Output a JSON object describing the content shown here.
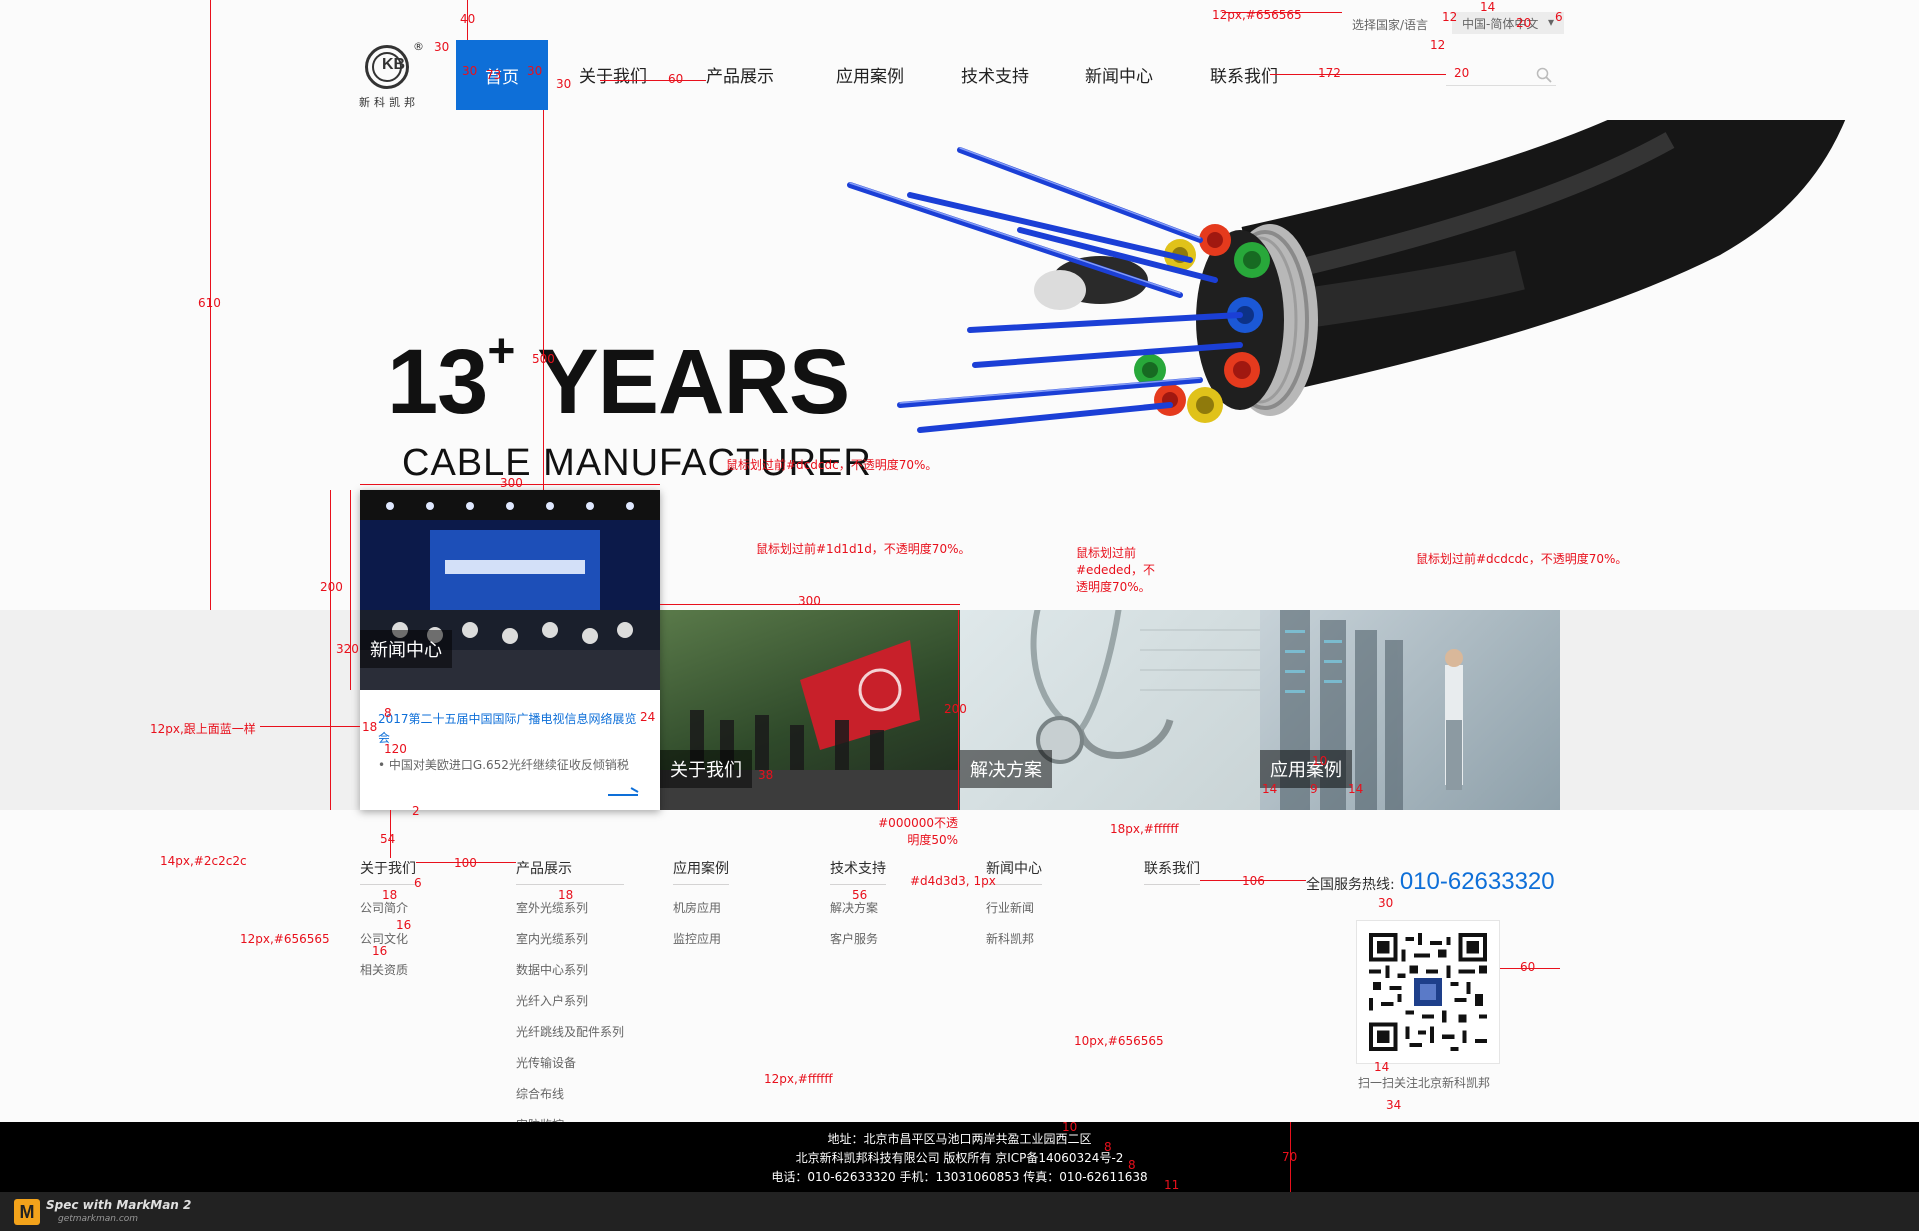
{
  "header": {
    "logo_mark": "KB",
    "logo_reg": "®",
    "logo_name": "新科凯邦",
    "home_label": "首页",
    "nav": [
      "关于我们",
      "产品展示",
      "应用案例",
      "技术支持",
      "新闻中心",
      "联系我们"
    ],
    "lang_label": "选择国家/语言",
    "lang_value": "中国-简体中文",
    "lang_arrow": "▾",
    "search_icon": "search-icon"
  },
  "hero": {
    "years": "13",
    "plus": "+",
    "years_word": " YEARS",
    "subtitle": "CABLE  MANUFACTURER"
  },
  "news_card": {
    "label": "新闻中心",
    "items": [
      "2017第二十五届中国国际广播电视信息网络展览会",
      "中国对美欧进口G.652光纤继续征收反倾销税"
    ],
    "bullet": "•",
    "more_icon": "arrow-right-icon"
  },
  "tiles": [
    {
      "label": "关于我们"
    },
    {
      "label": "解决方案"
    },
    {
      "label": "应用案例"
    }
  ],
  "footer_links": {
    "columns": [
      {
        "title": "关于我们",
        "links": [
          "公司简介",
          "公司文化",
          "相关资质"
        ]
      },
      {
        "title": "产品展示",
        "links": [
          "室外光缆系列",
          "室内光缆系列",
          "数据中心系列",
          "光纤入户系列",
          "光纤跳线及配件系列",
          "光传输设备",
          "综合布线",
          "安防监控"
        ]
      },
      {
        "title": "应用案例",
        "links": [
          "机房应用",
          "监控应用"
        ]
      },
      {
        "title": "技术支持",
        "links": [
          "解决方案",
          "客户服务"
        ]
      },
      {
        "title": "新闻中心",
        "links": [
          "行业新闻",
          "新科凯邦"
        ]
      },
      {
        "title": "联系我们",
        "links": []
      }
    ],
    "hotline_label": "全国服务热线:",
    "hotline_number": "010-62633320",
    "qr_caption": "扫一扫关注北京新科凯邦"
  },
  "footer_bar": {
    "address": "地址：北京市昌平区马池口两岸共盈工业园西二区",
    "copyright": "北京新科凯邦科技有限公司 版权所有  京ICP备14060324号-2",
    "contact": "电话：010-62633320    手机：13031060853    传真：010-62611638"
  },
  "markman": {
    "logo": "M",
    "text": "Spec with MarkMan 2",
    "url": "getmarkman.com"
  },
  "annotations": {
    "a40": "40",
    "a30a": "30",
    "a30b": "30",
    "a30c": "30",
    "a30d": "30",
    "a73": "73",
    "a60": "60",
    "a172": "172",
    "a20": "20",
    "a12a": "12",
    "a14a": "14",
    "a6a": "6",
    "a12b": "12",
    "a20b": "20",
    "color_top": "12px,#656565",
    "a610": "610",
    "a500": "500",
    "a300a": "300",
    "a300b": "300",
    "a200a": "200",
    "a320": "320",
    "hover1": "鼠标划过前#dcdcdc，不透明度70%。",
    "hover2": "鼠标划过前#1d1d1d，不透明度70%。",
    "hover3": "鼠标划过前#ededed，不透明度70%。",
    "hover4": "鼠标划过前#dcdcdc，不透明度70%。",
    "same_blue": "12px,跟上面蓝一样",
    "a18": "18",
    "a8": "8",
    "a24": "24",
    "a120": "120",
    "a2": "2",
    "a54": "54",
    "a200b": "200",
    "a38": "38",
    "a100": "100",
    "a10": "10",
    "a14b": "14",
    "a9": "9",
    "a14c": "14",
    "black50": "#000000不透明度50%",
    "white18": "18px,#ffffff",
    "c2c": "14px,#2c2c2c",
    "a100b": "100",
    "a6b": "6",
    "a18b": "18",
    "a18c": "18",
    "a16a": "16",
    "a16b": "16",
    "c656565": "12px,#656565",
    "d4d3d3": "#d4d3d3, 1px",
    "a56": "56",
    "a106": "106",
    "a30e": "30",
    "a60b": "60",
    "a14d": "14",
    "a34": "34",
    "c10px": "10px,#656565",
    "cfff": "12px,#ffffff",
    "a10b": "10",
    "a8b": "8",
    "a8c": "8",
    "a70": "70",
    "a11": "11"
  }
}
